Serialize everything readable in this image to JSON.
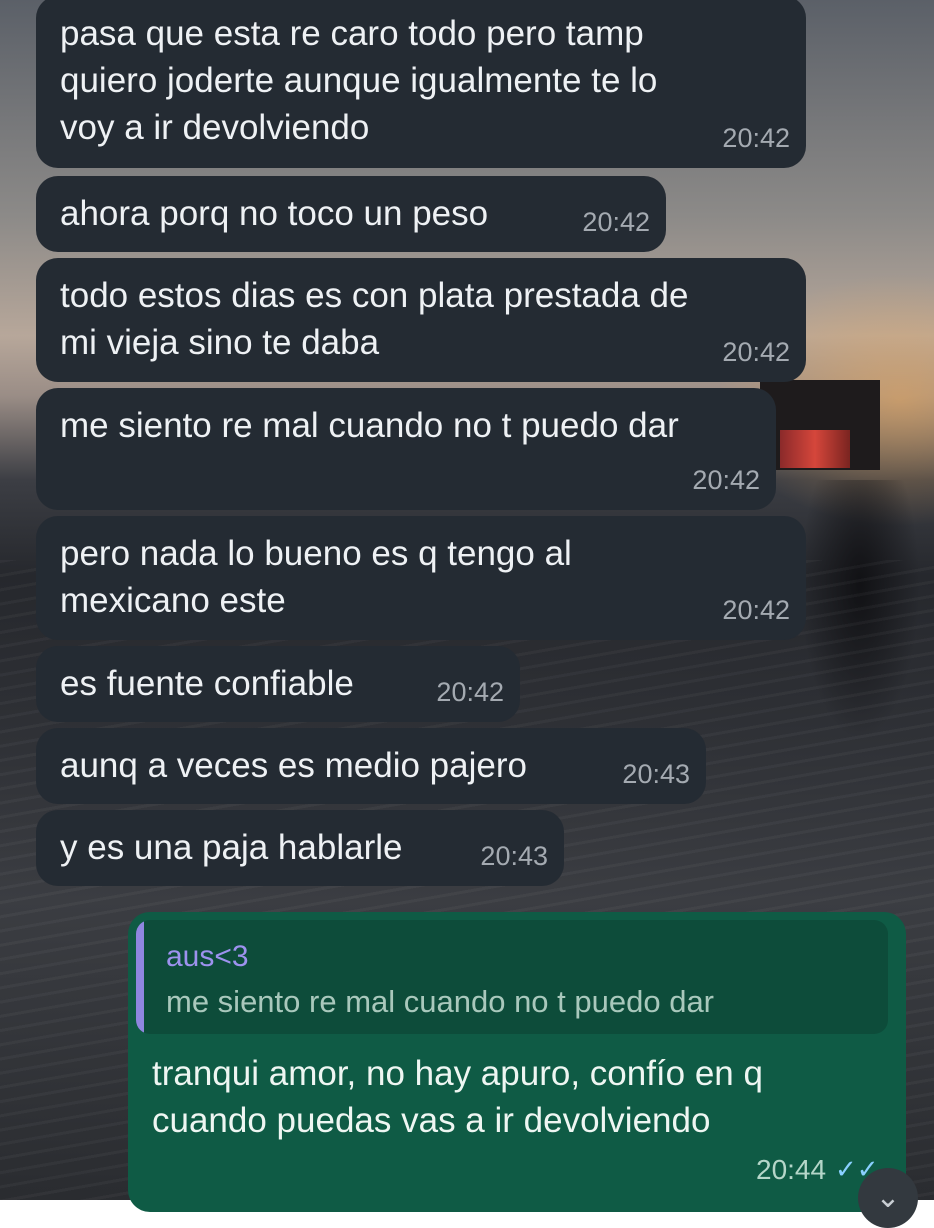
{
  "messages": [
    {
      "text": "pasa que esta re caro todo pero tamp\nquiero joderte aunque igualmente te lo\nvoy a ir devolviendo",
      "time": "20:42"
    },
    {
      "text": "ahora porq no toco un peso",
      "time": "20:42"
    },
    {
      "text": "todo estos dias es con plata prestada de\nmi vieja sino te daba",
      "time": "20:42"
    },
    {
      "text": "me siento re mal cuando no t puedo dar",
      "time": "20:42"
    },
    {
      "text": "pero nada lo bueno es q tengo al\nmexicano este",
      "time": "20:42"
    },
    {
      "text": "es fuente confiable",
      "time": "20:42"
    },
    {
      "text": "aunq a veces es medio pajero",
      "time": "20:43"
    },
    {
      "text": "y es una paja hablarle",
      "time": "20:43"
    }
  ],
  "reply": {
    "quoted_author": "aus<3",
    "quoted_text": "me siento re mal cuando no t puedo dar",
    "text": "tranqui amor, no hay apuro, confío en q\ncuando puedas vas a ir devolviendo",
    "time": "20:44",
    "status_icon": "double-check-icon"
  },
  "icons": {
    "scroll_down": "chevron-down-icon"
  },
  "colors": {
    "incoming_bubble": "#242b33",
    "outgoing_bubble": "#0f5b45",
    "quote_accent": "#8f86e0"
  }
}
